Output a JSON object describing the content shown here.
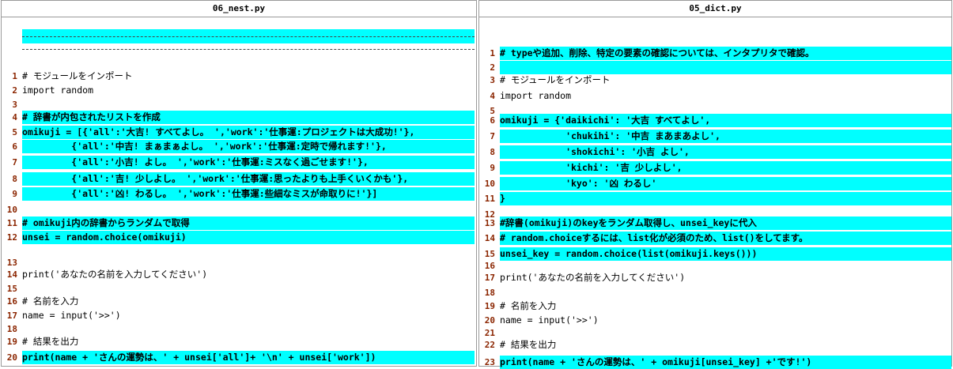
{
  "left": {
    "filename": "06_nest.py",
    "lines": [
      {
        "n": "",
        "text": "",
        "hl": false
      },
      {
        "n": "1",
        "text": "# モジュールをインポート",
        "hl": false
      },
      {
        "n": "2",
        "text": "import random",
        "hl": false
      },
      {
        "n": "3",
        "text": "",
        "hl": false
      },
      {
        "n": "4",
        "text": "# 辞書が内包されたリストを作成",
        "hl": true
      },
      {
        "n": "5",
        "text": "omikuji = [{'all':'大吉! すべてよし。 ','work':'仕事運:プロジェクトは大成功!'},",
        "hl": true
      },
      {
        "n": "6",
        "text": "         {'all':'中吉! まぁまぁよし。 ','work':'仕事運:定時で帰れます!'},",
        "hl": true
      },
      {
        "n": "7",
        "text": "         {'all':'小吉! よし。 ','work':'仕事運:ミスなく過ごせます!'},",
        "hl": true
      },
      {
        "n": "8",
        "text": "         {'all':'吉! 少しよし。 ','work':'仕事運:思ったよりも上手くいくかも'},",
        "hl": true
      },
      {
        "n": "9",
        "text": "         {'all':'凶! わるし。 ','work':'仕事運:些細なミスが命取りに!'}]",
        "hl": true
      },
      {
        "n": "10",
        "text": "",
        "hl": false
      },
      {
        "n": "11",
        "text": "# omikuji内の辞書からランダムで取得",
        "hl": true
      },
      {
        "n": "12",
        "text": "unsei = random.choice(omikuji)",
        "hl": true
      },
      {
        "n": "13",
        "text": "",
        "hl": false
      },
      {
        "n": "14",
        "text": "print('あなたの名前を入力してください')",
        "hl": false
      },
      {
        "n": "15",
        "text": "",
        "hl": false
      },
      {
        "n": "16",
        "text": "# 名前を入力",
        "hl": false
      },
      {
        "n": "17",
        "text": "name = input('>>')",
        "hl": false
      },
      {
        "n": "18",
        "text": "",
        "hl": false
      },
      {
        "n": "19",
        "text": "# 結果を出力",
        "hl": false
      },
      {
        "n": "20",
        "text": "print(name + 'さんの運勢は、' + unsei['all']+ '\\n' + unsei['work'])",
        "hl": true
      }
    ]
  },
  "right": {
    "filename": "05_dict.py",
    "lines": [
      {
        "n": "1",
        "text": "# typeや追加、削除、特定の要素の確認については、インタプリタで確認。",
        "hl": true
      },
      {
        "n": "2",
        "text": "",
        "hl": true
      },
      {
        "n": "3",
        "text": "# モジュールをインポート",
        "hl": false
      },
      {
        "n": "4",
        "text": "import random",
        "hl": false
      },
      {
        "n": "5",
        "text": "",
        "hl": false
      },
      {
        "n": "6",
        "text": "omikuji = {'daikichi': '大吉 すべてよし',",
        "hl": true
      },
      {
        "n": "7",
        "text": "            'chukihi': '中吉 まあまあよし',",
        "hl": true
      },
      {
        "n": "8",
        "text": "            'shokichi': '小吉 よし',",
        "hl": true
      },
      {
        "n": "9",
        "text": "            'kichi': '吉 少しよし',",
        "hl": true
      },
      {
        "n": "10",
        "text": "            'kyo': '凶 わるし'",
        "hl": true
      },
      {
        "n": "11",
        "text": "}",
        "hl": true
      },
      {
        "n": "12",
        "text": "",
        "hl": false
      },
      {
        "n": "13",
        "text": "#辞書(omikuji)のkeyをランダム取得し、unsei_keyに代入",
        "hl": true
      },
      {
        "n": "14",
        "text": "# random.choiceするには、list化が必須のため、list()をしてます。",
        "hl": true
      },
      {
        "n": "15",
        "text": "unsei_key = random.choice(list(omikuji.keys()))",
        "hl": true
      },
      {
        "n": "16",
        "text": "",
        "hl": false
      },
      {
        "n": "17",
        "text": "print('あなたの名前を入力してください')",
        "hl": false
      },
      {
        "n": "18",
        "text": "",
        "hl": false
      },
      {
        "n": "19",
        "text": "# 名前を入力",
        "hl": false
      },
      {
        "n": "20",
        "text": "name = input('>>')",
        "hl": false
      },
      {
        "n": "21",
        "text": "",
        "hl": false
      },
      {
        "n": "22",
        "text": "# 結果を出力",
        "hl": false
      },
      {
        "n": "23",
        "text": "print(name + 'さんの運勢は、' + omikuji[unsei_key] +'です!')",
        "hl": true
      }
    ]
  }
}
